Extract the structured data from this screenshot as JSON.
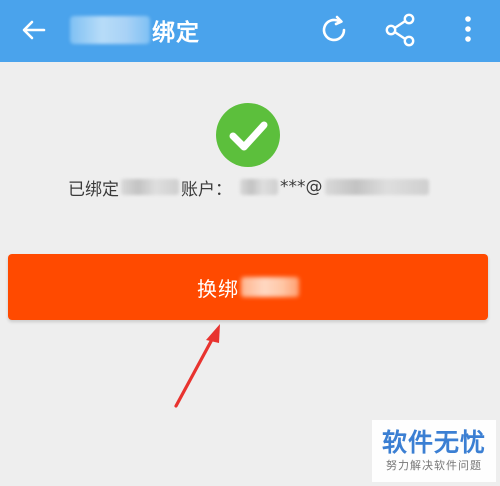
{
  "header": {
    "title": "绑定",
    "back_icon": "arrow-left-icon",
    "refresh_icon": "refresh-icon",
    "share_icon": "share-icon",
    "more_icon": "more-vertical-icon"
  },
  "status": {
    "icon": "check-circle-icon",
    "prefix": "已绑定",
    "account_label": "账户：",
    "account_masked": "***@"
  },
  "rebind_button": {
    "label": "换绑"
  },
  "annotation": {
    "arrow": "red-arrow-icon"
  },
  "watermark": {
    "main": "软件无忧",
    "sub": "努力解决软件问题"
  },
  "colors": {
    "header_bg": "#4aa3ec",
    "page_bg": "#eeeeee",
    "check_green": "#5cbf3c",
    "button_orange": "#ff4a00",
    "arrow_red": "#e8332f",
    "watermark_blue": "#3b7fd3"
  }
}
